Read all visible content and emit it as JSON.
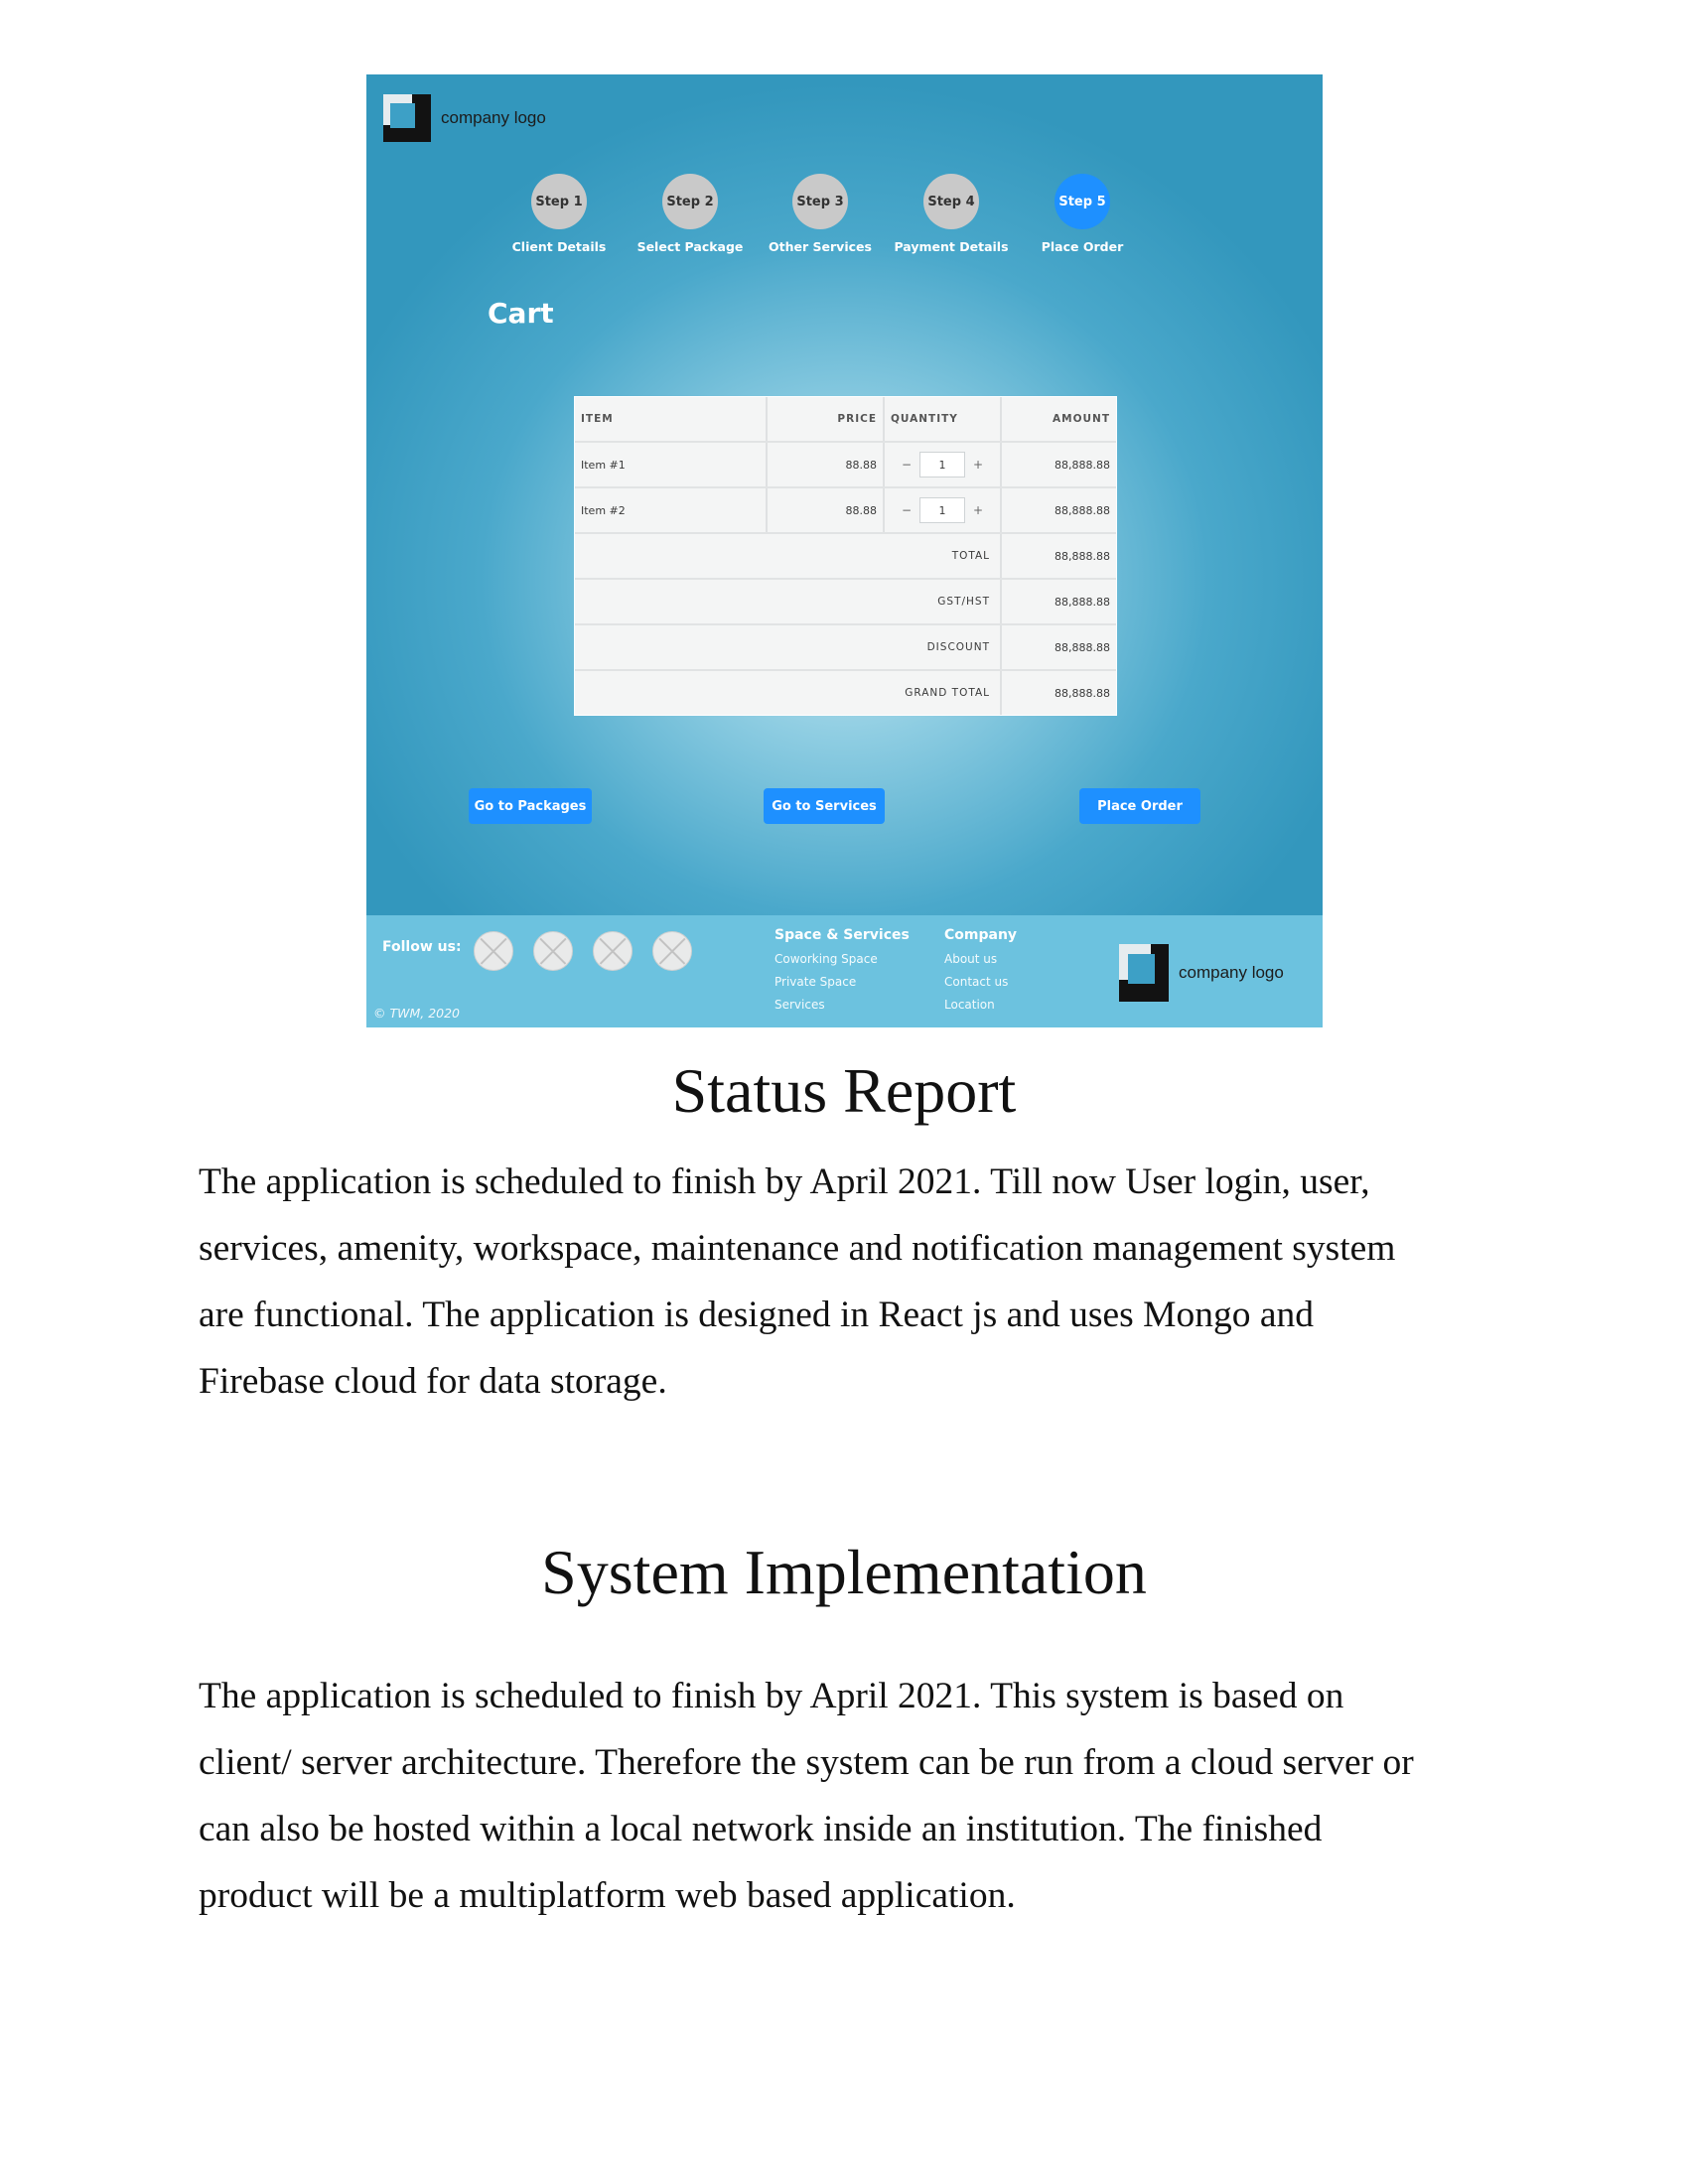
{
  "mockup": {
    "logo_text": "company logo",
    "steps": [
      {
        "step": "Step 1",
        "label": "Client Details",
        "active": false
      },
      {
        "step": "Step 2",
        "label": "Select Package",
        "active": false
      },
      {
        "step": "Step 3",
        "label": "Other Services",
        "active": false
      },
      {
        "step": "Step 4",
        "label": "Payment Details",
        "active": false
      },
      {
        "step": "Step 5",
        "label": "Place Order",
        "active": true
      }
    ],
    "cart_title": "Cart",
    "table": {
      "headers": {
        "item": "ITEM",
        "price": "PRICE",
        "quantity": "QUANTITY",
        "amount": "AMOUNT"
      },
      "rows": [
        {
          "item": "Item #1",
          "price": "88.88",
          "quantity": "1",
          "amount": "88,888.88"
        },
        {
          "item": "Item #2",
          "price": "88.88",
          "quantity": "1",
          "amount": "88,888.88"
        }
      ],
      "minus": "−",
      "plus": "+",
      "summary": [
        {
          "label": "TOTAL",
          "value": "88,888.88"
        },
        {
          "label": "GST/HST",
          "value": "88,888.88"
        },
        {
          "label": "DISCOUNT",
          "value": "88,888.88"
        },
        {
          "label": "GRAND TOTAL",
          "value": "88,888.88"
        }
      ]
    },
    "buttons": {
      "packages": "Go to Packages",
      "services": "Go to Services",
      "place_order": "Place Order"
    },
    "footer": {
      "follow": "Follow us:",
      "copyright": "© TWM, 2020",
      "col1": {
        "heading": "Space & Services",
        "links": [
          "Coworking Space",
          "Private Space",
          "Services"
        ]
      },
      "col2": {
        "heading": "Company",
        "links": [
          "About us",
          "Contact us",
          "Location"
        ]
      }
    },
    "colors": {
      "accent": "#1e90ff",
      "footer": "#6cc2df",
      "background": "#3397bd"
    }
  },
  "document": {
    "status_title": "Status Report",
    "status_lines": [
      "The application is scheduled to finish by April 2021. Till now User login, user,",
      "services, amenity, workspace, maintenance and notification management system",
      "are functional. The application is designed in React js and uses Mongo  and",
      "Firebase cloud for data storage."
    ],
    "impl_title": "System Implementation",
    "impl_lines": [
      "The application is scheduled to finish by April 2021. This system is based on",
      "client/ server architecture. Therefore the system can be run from a cloud server or",
      "can also be hosted within a local network inside an institution. The finished",
      "product will be a multiplatform web based application."
    ]
  }
}
